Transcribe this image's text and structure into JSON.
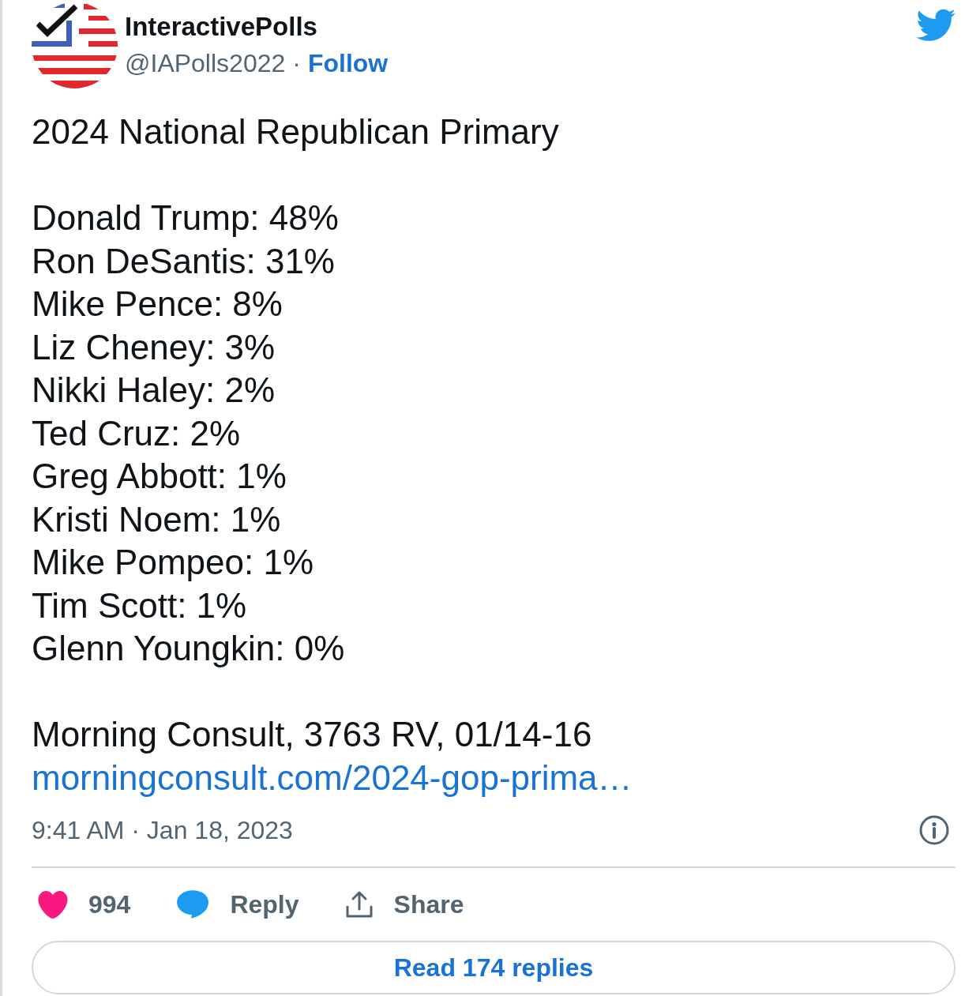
{
  "tweet": {
    "author": {
      "name": "InteractivePolls",
      "handle": "@IAPolls2022",
      "separator": "·",
      "follow": "Follow"
    },
    "body": {
      "title": "2024 National Republican Primary",
      "results": [
        "Donald Trump: 48%",
        "Ron DeSantis: 31%",
        "Mike Pence: 8%",
        "Liz Cheney: 3%",
        "Nikki Haley: 2%",
        "Ted Cruz: 2%",
        "Greg Abbott: 1%",
        "Kristi Noem: 1%",
        "Mike Pompeo: 1%",
        "Tim Scott: 1%",
        "Glenn Youngkin: 0%"
      ],
      "source": "Morning Consult, 3763 RV, 01/14-16",
      "link": "morningconsult.com/2024-gop-prima…"
    },
    "timestamp": "9:41 AM · Jan 18, 2023",
    "actions": [
      {
        "kind": "like",
        "label": "994"
      },
      {
        "kind": "reply",
        "label": "Reply"
      },
      {
        "kind": "share",
        "label": "Share"
      }
    ],
    "read_replies": "Read 174 replies"
  }
}
